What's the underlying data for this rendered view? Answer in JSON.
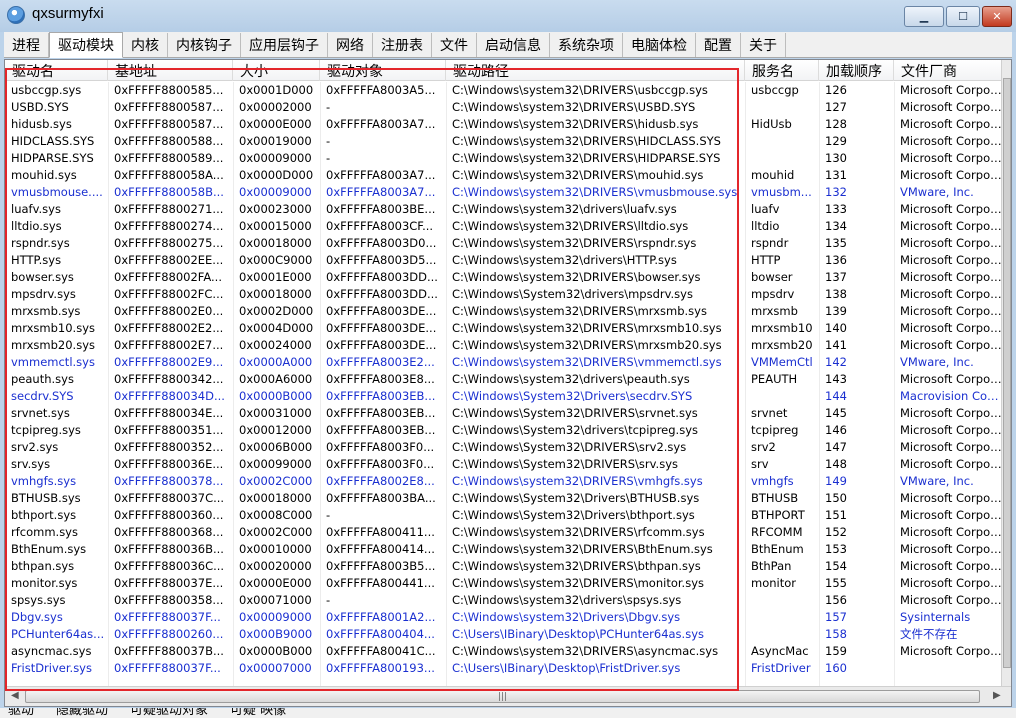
{
  "window": {
    "title": "qxsurmyfxi"
  },
  "tabs": [
    {
      "label": "进程",
      "name": "tab-process"
    },
    {
      "label": "驱动模块",
      "name": "tab-driver-modules",
      "active": true
    },
    {
      "label": "内核",
      "name": "tab-kernel"
    },
    {
      "label": "内核钩子",
      "name": "tab-kernel-hooks"
    },
    {
      "label": "应用层钩子",
      "name": "tab-user-hooks"
    },
    {
      "label": "网络",
      "name": "tab-network"
    },
    {
      "label": "注册表",
      "name": "tab-registry"
    },
    {
      "label": "文件",
      "name": "tab-file"
    },
    {
      "label": "启动信息",
      "name": "tab-startup"
    },
    {
      "label": "系统杂项",
      "name": "tab-misc"
    },
    {
      "label": "电脑体检",
      "name": "tab-checkup"
    },
    {
      "label": "配置",
      "name": "tab-config"
    },
    {
      "label": "关于",
      "name": "tab-about"
    }
  ],
  "columns": [
    "驱动名",
    "基地址",
    "大小",
    "驱动对象",
    "驱动路径",
    "服务名",
    "加载顺序",
    "文件厂商"
  ],
  "rows": [
    {
      "blue": false,
      "cells": [
        "usbccgp.sys",
        "0xFFFFF8800585...",
        "0x0001D000",
        "0xFFFFFA8003A5...",
        "C:\\Windows\\system32\\DRIVERS\\usbccgp.sys",
        "usbccgp",
        "126",
        "Microsoft Corpor..."
      ]
    },
    {
      "blue": false,
      "cells": [
        "USBD.SYS",
        "0xFFFFF8800587...",
        "0x00002000",
        "-",
        "C:\\Windows\\system32\\DRIVERS\\USBD.SYS",
        "",
        "127",
        "Microsoft Corpor..."
      ]
    },
    {
      "blue": false,
      "cells": [
        "hidusb.sys",
        "0xFFFFF8800587...",
        "0x0000E000",
        "0xFFFFFA8003A7...",
        "C:\\Windows\\system32\\DRIVERS\\hidusb.sys",
        "HidUsb",
        "128",
        "Microsoft Corpor..."
      ]
    },
    {
      "blue": false,
      "cells": [
        "HIDCLASS.SYS",
        "0xFFFFF8800588...",
        "0x00019000",
        "-",
        "C:\\Windows\\system32\\DRIVERS\\HIDCLASS.SYS",
        "",
        "129",
        "Microsoft Corpor..."
      ]
    },
    {
      "blue": false,
      "cells": [
        "HIDPARSE.SYS",
        "0xFFFFF8800589...",
        "0x00009000",
        "-",
        "C:\\Windows\\system32\\DRIVERS\\HIDPARSE.SYS",
        "",
        "130",
        "Microsoft Corpor..."
      ]
    },
    {
      "blue": false,
      "cells": [
        "mouhid.sys",
        "0xFFFFF880058A...",
        "0x0000D000",
        "0xFFFFFA8003A7...",
        "C:\\Windows\\system32\\DRIVERS\\mouhid.sys",
        "mouhid",
        "131",
        "Microsoft Corpor..."
      ]
    },
    {
      "blue": true,
      "cells": [
        "vmusbmouse....",
        "0xFFFFF880058B...",
        "0x00009000",
        "0xFFFFFA8003A7...",
        "C:\\Windows\\system32\\DRIVERS\\vmusbmouse.sys",
        "vmusbm...",
        "132",
        "VMware, Inc."
      ]
    },
    {
      "blue": false,
      "cells": [
        "luafv.sys",
        "0xFFFFF8800271...",
        "0x00023000",
        "0xFFFFFA8003BE...",
        "C:\\Windows\\system32\\drivers\\luafv.sys",
        "luafv",
        "133",
        "Microsoft Corpor..."
      ]
    },
    {
      "blue": false,
      "cells": [
        "lltdio.sys",
        "0xFFFFF8800274...",
        "0x00015000",
        "0xFFFFFA8003CF...",
        "C:\\Windows\\system32\\DRIVERS\\lltdio.sys",
        "lltdio",
        "134",
        "Microsoft Corpor..."
      ]
    },
    {
      "blue": false,
      "cells": [
        "rspndr.sys",
        "0xFFFFF8800275...",
        "0x00018000",
        "0xFFFFFA8003D0...",
        "C:\\Windows\\system32\\DRIVERS\\rspndr.sys",
        "rspndr",
        "135",
        "Microsoft Corpor..."
      ]
    },
    {
      "blue": false,
      "cells": [
        "HTTP.sys",
        "0xFFFFF88002EE...",
        "0x000C9000",
        "0xFFFFFA8003D5...",
        "C:\\Windows\\system32\\drivers\\HTTP.sys",
        "HTTP",
        "136",
        "Microsoft Corpor..."
      ]
    },
    {
      "blue": false,
      "cells": [
        "bowser.sys",
        "0xFFFFF88002FA...",
        "0x0001E000",
        "0xFFFFFA8003DD...",
        "C:\\Windows\\system32\\DRIVERS\\bowser.sys",
        "bowser",
        "137",
        "Microsoft Corpor..."
      ]
    },
    {
      "blue": false,
      "cells": [
        "mpsdrv.sys",
        "0xFFFFF88002FC...",
        "0x00018000",
        "0xFFFFFA8003DD...",
        "C:\\Windows\\System32\\drivers\\mpsdrv.sys",
        "mpsdrv",
        "138",
        "Microsoft Corpor..."
      ]
    },
    {
      "blue": false,
      "cells": [
        "mrxsmb.sys",
        "0xFFFFF88002E0...",
        "0x0002D000",
        "0xFFFFFA8003DE...",
        "C:\\Windows\\system32\\DRIVERS\\mrxsmb.sys",
        "mrxsmb",
        "139",
        "Microsoft Corpor..."
      ]
    },
    {
      "blue": false,
      "cells": [
        "mrxsmb10.sys",
        "0xFFFFF88002E2...",
        "0x0004D000",
        "0xFFFFFA8003DE...",
        "C:\\Windows\\system32\\DRIVERS\\mrxsmb10.sys",
        "mrxsmb10",
        "140",
        "Microsoft Corpor..."
      ]
    },
    {
      "blue": false,
      "cells": [
        "mrxsmb20.sys",
        "0xFFFFF88002E7...",
        "0x00024000",
        "0xFFFFFA8003DE...",
        "C:\\Windows\\system32\\DRIVERS\\mrxsmb20.sys",
        "mrxsmb20",
        "141",
        "Microsoft Corpor..."
      ]
    },
    {
      "blue": true,
      "cells": [
        "vmmemctl.sys",
        "0xFFFFF88002E9...",
        "0x0000A000",
        "0xFFFFFA8003E2...",
        "C:\\Windows\\system32\\DRIVERS\\vmmemctl.sys",
        "VMMemCtl",
        "142",
        "VMware, Inc."
      ]
    },
    {
      "blue": false,
      "cells": [
        "peauth.sys",
        "0xFFFFF8800342...",
        "0x000A6000",
        "0xFFFFFA8003E8...",
        "C:\\Windows\\system32\\drivers\\peauth.sys",
        "PEAUTH",
        "143",
        "Microsoft Corpor..."
      ]
    },
    {
      "blue": true,
      "cells": [
        "secdrv.SYS",
        "0xFFFFF880034D...",
        "0x0000B000",
        "0xFFFFFA8003EB...",
        "C:\\Windows\\System32\\Drivers\\secdrv.SYS",
        "",
        "144",
        "Macrovision Corp..."
      ]
    },
    {
      "blue": false,
      "cells": [
        "srvnet.sys",
        "0xFFFFF880034E...",
        "0x00031000",
        "0xFFFFFA8003EB...",
        "C:\\Windows\\System32\\DRIVERS\\srvnet.sys",
        "srvnet",
        "145",
        "Microsoft Corpor..."
      ]
    },
    {
      "blue": false,
      "cells": [
        "tcpipreg.sys",
        "0xFFFFF8800351...",
        "0x00012000",
        "0xFFFFFA8003EB...",
        "C:\\Windows\\System32\\drivers\\tcpipreg.sys",
        "tcpipreg",
        "146",
        "Microsoft Corpor..."
      ]
    },
    {
      "blue": false,
      "cells": [
        "srv2.sys",
        "0xFFFFF8800352...",
        "0x0006B000",
        "0xFFFFFA8003F0...",
        "C:\\Windows\\System32\\DRIVERS\\srv2.sys",
        "srv2",
        "147",
        "Microsoft Corpor..."
      ]
    },
    {
      "blue": false,
      "cells": [
        "srv.sys",
        "0xFFFFF880036E...",
        "0x00099000",
        "0xFFFFFA8003F0...",
        "C:\\Windows\\System32\\DRIVERS\\srv.sys",
        "srv",
        "148",
        "Microsoft Corpor..."
      ]
    },
    {
      "blue": true,
      "cells": [
        "vmhgfs.sys",
        "0xFFFFF8800378...",
        "0x0002C000",
        "0xFFFFFA8002E8...",
        "C:\\Windows\\system32\\DRIVERS\\vmhgfs.sys",
        "vmhgfs",
        "149",
        "VMware, Inc."
      ]
    },
    {
      "blue": false,
      "cells": [
        "BTHUSB.sys",
        "0xFFFFF880037C...",
        "0x00018000",
        "0xFFFFFA8003BA...",
        "C:\\Windows\\System32\\Drivers\\BTHUSB.sys",
        "BTHUSB",
        "150",
        "Microsoft Corpor..."
      ]
    },
    {
      "blue": false,
      "cells": [
        "bthport.sys",
        "0xFFFFF8800360...",
        "0x0008C000",
        "-",
        "C:\\Windows\\System32\\Drivers\\bthport.sys",
        "BTHPORT",
        "151",
        "Microsoft Corpor..."
      ]
    },
    {
      "blue": false,
      "cells": [
        "rfcomm.sys",
        "0xFFFFF8800368...",
        "0x0002C000",
        "0xFFFFFA800411...",
        "C:\\Windows\\system32\\DRIVERS\\rfcomm.sys",
        "RFCOMM",
        "152",
        "Microsoft Corpor..."
      ]
    },
    {
      "blue": false,
      "cells": [
        "BthEnum.sys",
        "0xFFFFF880036B...",
        "0x00010000",
        "0xFFFFFA800414...",
        "C:\\Windows\\system32\\DRIVERS\\BthEnum.sys",
        "BthEnum",
        "153",
        "Microsoft Corpor..."
      ]
    },
    {
      "blue": false,
      "cells": [
        "bthpan.sys",
        "0xFFFFF880036C...",
        "0x00020000",
        "0xFFFFFA8003B5...",
        "C:\\Windows\\system32\\DRIVERS\\bthpan.sys",
        "BthPan",
        "154",
        "Microsoft Corpor..."
      ]
    },
    {
      "blue": false,
      "cells": [
        "monitor.sys",
        "0xFFFFF880037E...",
        "0x0000E000",
        "0xFFFFFA800441...",
        "C:\\Windows\\system32\\DRIVERS\\monitor.sys",
        "monitor",
        "155",
        "Microsoft Corpor..."
      ]
    },
    {
      "blue": false,
      "cells": [
        "spsys.sys",
        "0xFFFFF8800358...",
        "0x00071000",
        "-",
        "C:\\Windows\\system32\\drivers\\spsys.sys",
        "",
        "156",
        "Microsoft Corpor..."
      ]
    },
    {
      "blue": true,
      "cells": [
        "Dbgv.sys",
        "0xFFFFF880037F...",
        "0x00009000",
        "0xFFFFFA8001A2...",
        "C:\\Windows\\system32\\Drivers\\Dbgv.sys",
        "",
        "157",
        "Sysinternals"
      ]
    },
    {
      "blue": true,
      "cells": [
        "PCHunter64as...",
        "0xFFFFF8800260...",
        "0x000B9000",
        "0xFFFFFA800404...",
        "C:\\Users\\IBinary\\Desktop\\PCHunter64as.sys",
        "",
        "158",
        "文件不存在"
      ]
    },
    {
      "blue": false,
      "cells": [
        "asyncmac.sys",
        "0xFFFFF880037B...",
        "0x0000B000",
        "0xFFFFFA80041C...",
        "C:\\Windows\\system32\\DRIVERS\\asyncmac.sys",
        "AsyncMac",
        "159",
        "Microsoft Corpor..."
      ]
    },
    {
      "blue": true,
      "cells": [
        "FristDriver.sys",
        "0xFFFFF880037F...",
        "0x00007000",
        "0xFFFFFA800193...",
        "C:\\Users\\IBinary\\Desktop\\FristDriver.sys",
        "FristDriver",
        "160",
        ""
      ]
    }
  ],
  "colors": {
    "system_driver_text": "#000000",
    "third_party_driver_text": "#1a2fd0",
    "highlight_box": "#e3262b"
  },
  "statusbar": [
    "驱动",
    "隐藏驱动",
    "可疑驱动对象",
    "可疑 映像"
  ]
}
